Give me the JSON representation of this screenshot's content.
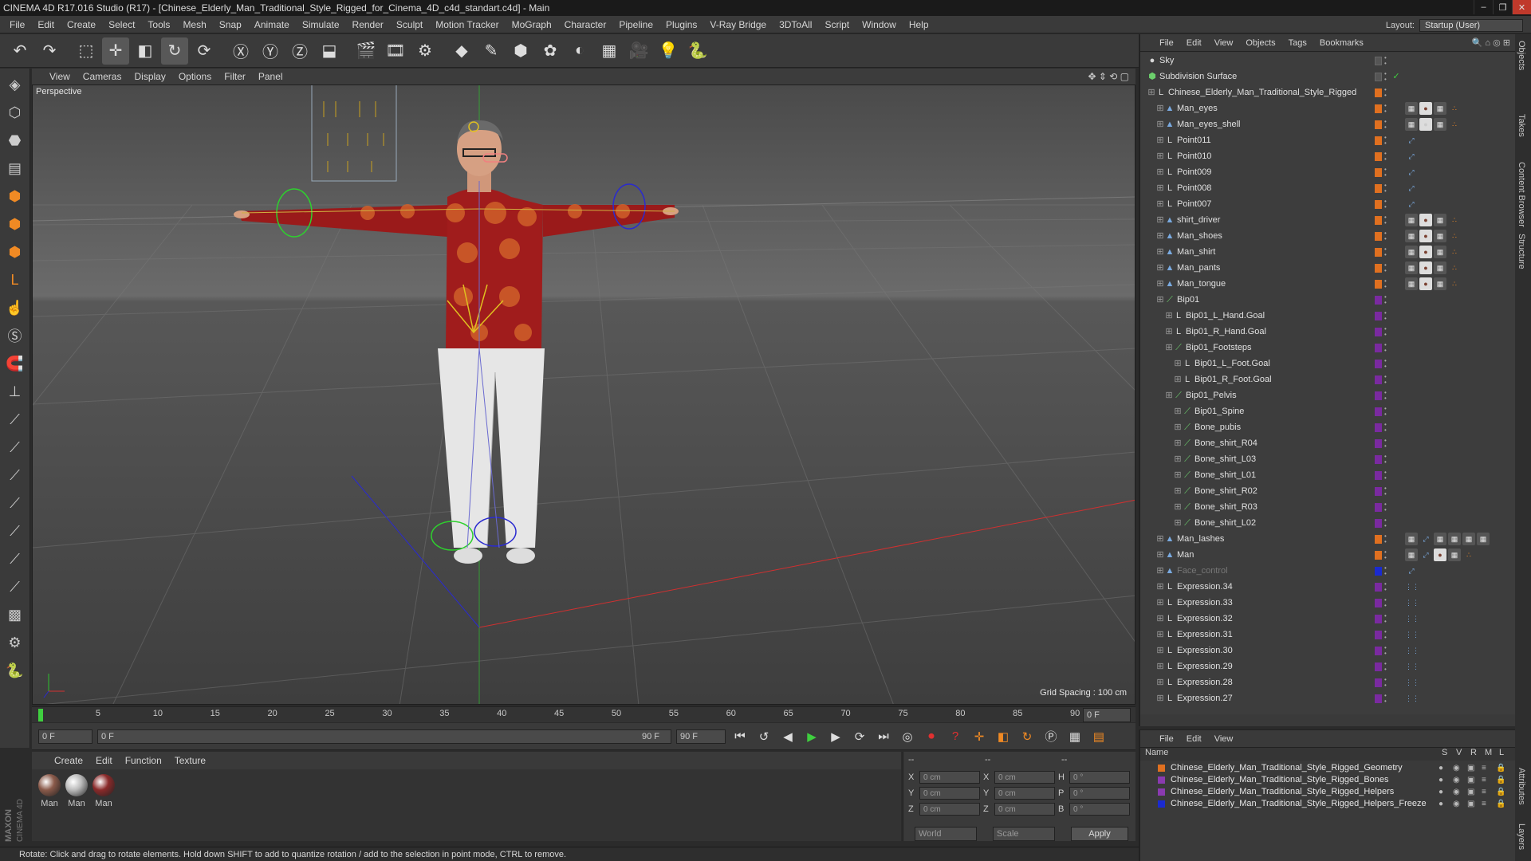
{
  "window": {
    "title": "CINEMA 4D R17.016 Studio (R17) - [Chinese_Elderly_Man_Traditional_Style_Rigged_for_Cinema_4D_c4d_standart.c4d] - Main",
    "controls": [
      "–",
      "❐",
      "✕"
    ]
  },
  "menubar": [
    "File",
    "Edit",
    "Create",
    "Select",
    "Tools",
    "Mesh",
    "Snap",
    "Animate",
    "Simulate",
    "Render",
    "Sculpt",
    "Motion Tracker",
    "MoGraph",
    "Character",
    "Pipeline",
    "Plugins",
    "V-Ray Bridge",
    "3DToAll",
    "Script",
    "Window",
    "Help"
  ],
  "layout": {
    "label": "Layout:",
    "value": "Startup (User)"
  },
  "toolbar": [
    {
      "name": "undo-icon",
      "glyph": "↶"
    },
    {
      "name": "redo-icon",
      "glyph": "↷"
    },
    {
      "sep": true
    },
    {
      "name": "live-select-icon",
      "glyph": "⬚"
    },
    {
      "name": "move-icon",
      "glyph": "✛",
      "hl": true
    },
    {
      "name": "scale-icon",
      "glyph": "◧"
    },
    {
      "name": "rotate-icon",
      "glyph": "↻",
      "hl": true
    },
    {
      "name": "recent-tool-icon",
      "glyph": "⟳"
    },
    {
      "sep": true
    },
    {
      "name": "x-axis-icon",
      "glyph": "Ⓧ"
    },
    {
      "name": "y-axis-icon",
      "glyph": "Ⓨ"
    },
    {
      "name": "z-axis-icon",
      "glyph": "Ⓩ"
    },
    {
      "name": "coordinate-system-icon",
      "glyph": "⬓"
    },
    {
      "sep": true
    },
    {
      "name": "render-view-icon",
      "glyph": "🎬"
    },
    {
      "name": "render-picture-viewer-icon",
      "glyph": "🎞"
    },
    {
      "name": "render-settings-icon",
      "glyph": "⚙"
    },
    {
      "sep": true
    },
    {
      "name": "cube-icon",
      "glyph": "◆"
    },
    {
      "name": "spline-pen-icon",
      "glyph": "✎"
    },
    {
      "name": "subdivision-icon",
      "glyph": "⬢"
    },
    {
      "name": "array-icon",
      "glyph": "✿"
    },
    {
      "name": "deformer-icon",
      "glyph": "◐"
    },
    {
      "name": "floor-icon",
      "glyph": "▦"
    },
    {
      "name": "camera-icon",
      "glyph": "🎥"
    },
    {
      "name": "light-icon",
      "glyph": "💡"
    },
    {
      "name": "python-icon",
      "glyph": "🐍"
    }
  ],
  "lefttools": [
    {
      "name": "model-mode-icon",
      "glyph": "◈"
    },
    {
      "name": "object-mode-icon",
      "glyph": "⬡"
    },
    {
      "name": "texture-mode-icon",
      "glyph": "⬣"
    },
    {
      "name": "workplane-icon",
      "glyph": "▤"
    },
    {
      "name": "points-mode-icon",
      "glyph": "⬢",
      "org": true
    },
    {
      "name": "edges-mode-icon",
      "glyph": "⬢",
      "org": true
    },
    {
      "name": "polygons-mode-icon",
      "glyph": "⬢",
      "org": true
    },
    {
      "name": "axis-mode-icon",
      "glyph": "L",
      "org": true
    },
    {
      "name": "tweak-mode-icon",
      "glyph": "☝"
    },
    {
      "name": "snap-icon",
      "glyph": "Ⓢ"
    },
    {
      "name": "magnet-icon",
      "glyph": "🧲",
      "org": true
    },
    {
      "name": "quantize-icon",
      "glyph": "⊥"
    },
    {
      "name": "joint-tool-icon",
      "glyph": "⟋"
    },
    {
      "name": "bone-tool-icon",
      "glyph": "⟋"
    },
    {
      "name": "ik-tool-icon",
      "glyph": "⟋"
    },
    {
      "name": "weight-tool-icon",
      "glyph": "⟋"
    },
    {
      "name": "paint-tool-icon",
      "glyph": "⟋"
    },
    {
      "name": "skin-tool-icon",
      "glyph": "⟋"
    },
    {
      "name": "mirror-tool-icon",
      "glyph": "⟋"
    },
    {
      "name": "checker-icon",
      "glyph": "▩"
    },
    {
      "name": "brush-icon",
      "glyph": "⚙"
    },
    {
      "name": "python-script-icon",
      "glyph": "🐍"
    }
  ],
  "viewport": {
    "menu": [
      "View",
      "Cameras",
      "Display",
      "Options",
      "Filter",
      "Panel"
    ],
    "label": "Perspective",
    "grid_spacing": "Grid Spacing : 100 cm"
  },
  "timeline": {
    "ticks": [
      "0",
      "5",
      "10",
      "15",
      "20",
      "25",
      "30",
      "35",
      "40",
      "45",
      "50",
      "55",
      "60",
      "65",
      "70",
      "75",
      "80",
      "85",
      "90"
    ],
    "current_frame": "0 F",
    "start": "0 F",
    "range_start": "0 F",
    "range_end": "90 F",
    "end": "90 F"
  },
  "materials": {
    "menu": [
      "Create",
      "Edit",
      "Function",
      "Texture"
    ],
    "items": [
      {
        "label": "Man",
        "color": "#8a5a4a"
      },
      {
        "label": "Man",
        "color": "#bbbbbb"
      },
      {
        "label": "Man",
        "color": "#8a2a2a"
      }
    ]
  },
  "coords": {
    "header": [
      "--",
      "--",
      "--"
    ],
    "rows": [
      {
        "a": "X",
        "v1": "0 cm",
        "b": "X",
        "v2": "0 cm",
        "c": "H",
        "v3": "0 °"
      },
      {
        "a": "Y",
        "v1": "0 cm",
        "b": "Y",
        "v2": "0 cm",
        "c": "P",
        "v3": "0 °"
      },
      {
        "a": "Z",
        "v1": "0 cm",
        "b": "Z",
        "v2": "0 cm",
        "c": "B",
        "v3": "0 °"
      }
    ],
    "world": "World",
    "scale": "Scale",
    "apply": "Apply"
  },
  "status": "Rotate: Click and drag to rotate elements. Hold down SHIFT to add to quantize rotation / add to the selection in point mode, CTRL to remove.",
  "objects": {
    "menu": [
      "File",
      "Edit",
      "View",
      "Objects",
      "Tags",
      "Bookmarks"
    ],
    "rows": [
      {
        "name": "Sky",
        "level": 0,
        "icon": "sky",
        "flag": "none",
        "tags": []
      },
      {
        "name": "Subdivision Surface",
        "level": 0,
        "icon": "sds",
        "flag": "none",
        "tags": [],
        "check": true
      },
      {
        "name": "Chinese_Elderly_Man_Traditional_Style_Rigged",
        "level": 1,
        "icon": "null",
        "flag": "orange",
        "tags": []
      },
      {
        "name": "Man_eyes",
        "level": 2,
        "icon": "mesh",
        "flag": "orange",
        "tags": [
          "ck",
          "mat",
          "ck",
          "wt"
        ]
      },
      {
        "name": "Man_eyes_shell",
        "level": 2,
        "icon": "mesh",
        "flag": "orange",
        "tags": [
          "ck",
          "mat2",
          "ck",
          "wt"
        ]
      },
      {
        "name": "Point011",
        "level": 2,
        "icon": "null",
        "flag": "orange",
        "tags": [
          "pin"
        ]
      },
      {
        "name": "Point010",
        "level": 2,
        "icon": "null",
        "flag": "orange",
        "tags": [
          "pin"
        ]
      },
      {
        "name": "Point009",
        "level": 2,
        "icon": "null",
        "flag": "orange",
        "tags": [
          "pin"
        ]
      },
      {
        "name": "Point008",
        "level": 2,
        "icon": "null",
        "flag": "orange",
        "tags": [
          "pin"
        ]
      },
      {
        "name": "Point007",
        "level": 2,
        "icon": "null",
        "flag": "orange",
        "tags": [
          "pin"
        ]
      },
      {
        "name": "shirt_driver",
        "level": 2,
        "icon": "mesh",
        "flag": "orange",
        "tags": [
          "ck",
          "mat",
          "ck",
          "wt"
        ]
      },
      {
        "name": "Man_shoes",
        "level": 2,
        "icon": "mesh",
        "flag": "orange",
        "tags": [
          "ck",
          "mat",
          "ck",
          "wt"
        ]
      },
      {
        "name": "Man_shirt",
        "level": 2,
        "icon": "mesh",
        "flag": "orange",
        "tags": [
          "ck",
          "mat",
          "ck",
          "wt"
        ]
      },
      {
        "name": "Man_pants",
        "level": 2,
        "icon": "mesh",
        "flag": "orange",
        "tags": [
          "ck",
          "mat",
          "ck",
          "wt"
        ]
      },
      {
        "name": "Man_tongue",
        "level": 2,
        "icon": "mesh",
        "flag": "orange",
        "tags": [
          "ck",
          "mat",
          "ck",
          "wt"
        ]
      },
      {
        "name": "Bip01",
        "level": 2,
        "icon": "bone",
        "flag": "purple",
        "tags": []
      },
      {
        "name": "Bip01_L_Hand.Goal",
        "level": 3,
        "icon": "null",
        "flag": "purple",
        "tags": []
      },
      {
        "name": "Bip01_R_Hand.Goal",
        "level": 3,
        "icon": "null",
        "flag": "purple",
        "tags": []
      },
      {
        "name": "Bip01_Footsteps",
        "level": 3,
        "icon": "bone",
        "flag": "purple",
        "tags": []
      },
      {
        "name": "Bip01_L_Foot.Goal",
        "level": 4,
        "icon": "null",
        "flag": "purple",
        "tags": []
      },
      {
        "name": "Bip01_R_Foot.Goal",
        "level": 4,
        "icon": "null",
        "flag": "purple",
        "tags": []
      },
      {
        "name": "Bip01_Pelvis",
        "level": 3,
        "icon": "bone",
        "flag": "purple",
        "tags": []
      },
      {
        "name": "Bip01_Spine",
        "level": 4,
        "icon": "bone",
        "flag": "purple",
        "tags": []
      },
      {
        "name": "Bone_pubis",
        "level": 4,
        "icon": "bone",
        "flag": "purple",
        "tags": []
      },
      {
        "name": "Bone_shirt_R04",
        "level": 4,
        "icon": "bone",
        "flag": "purple",
        "tags": []
      },
      {
        "name": "Bone_shirt_L03",
        "level": 4,
        "icon": "bone",
        "flag": "purple",
        "tags": []
      },
      {
        "name": "Bone_shirt_L01",
        "level": 4,
        "icon": "bone",
        "flag": "purple",
        "tags": []
      },
      {
        "name": "Bone_shirt_R02",
        "level": 4,
        "icon": "bone",
        "flag": "purple",
        "tags": []
      },
      {
        "name": "Bone_shirt_R03",
        "level": 4,
        "icon": "bone",
        "flag": "purple",
        "tags": []
      },
      {
        "name": "Bone_shirt_L02",
        "level": 4,
        "icon": "bone",
        "flag": "purple",
        "tags": []
      },
      {
        "name": "Man_lashes",
        "level": 2,
        "icon": "mesh",
        "flag": "orange",
        "tags": [
          "ck",
          "pin",
          "ck",
          "ck",
          "ck",
          "ck"
        ]
      },
      {
        "name": "Man",
        "level": 2,
        "icon": "mesh",
        "flag": "orange",
        "tags": [
          "ck",
          "pin",
          "mat",
          "ck",
          "wt"
        ]
      },
      {
        "name": "Face_control",
        "level": 2,
        "icon": "mesh",
        "flag": "blue",
        "tags": [
          "pin"
        ],
        "dim": true
      },
      {
        "name": "Expression.34",
        "level": 2,
        "icon": "null",
        "flag": "purple",
        "tags": [
          "xp"
        ]
      },
      {
        "name": "Expression.33",
        "level": 2,
        "icon": "null",
        "flag": "purple",
        "tags": [
          "xp"
        ]
      },
      {
        "name": "Expression.32",
        "level": 2,
        "icon": "null",
        "flag": "purple",
        "tags": [
          "xp"
        ]
      },
      {
        "name": "Expression.31",
        "level": 2,
        "icon": "null",
        "flag": "purple",
        "tags": [
          "xp"
        ]
      },
      {
        "name": "Expression.30",
        "level": 2,
        "icon": "null",
        "flag": "purple",
        "tags": [
          "xp"
        ]
      },
      {
        "name": "Expression.29",
        "level": 2,
        "icon": "null",
        "flag": "purple",
        "tags": [
          "xp"
        ]
      },
      {
        "name": "Expression.28",
        "level": 2,
        "icon": "null",
        "flag": "purple",
        "tags": [
          "xp"
        ]
      },
      {
        "name": "Expression.27",
        "level": 2,
        "icon": "null",
        "flag": "purple",
        "tags": [
          "xp"
        ]
      }
    ]
  },
  "layers": {
    "menu": [
      "File",
      "Edit",
      "View"
    ],
    "header": {
      "name": "Name",
      "cols": [
        "S",
        "V",
        "R",
        "M",
        "L"
      ]
    },
    "rows": [
      {
        "name": "Chinese_Elderly_Man_Traditional_Style_Rigged_Geometry",
        "color": "#e07020"
      },
      {
        "name": "Chinese_Elderly_Man_Traditional_Style_Rigged_Bones",
        "color": "#8a3ab0"
      },
      {
        "name": "Chinese_Elderly_Man_Traditional_Style_Rigged_Helpers",
        "color": "#8a3ab0"
      },
      {
        "name": "Chinese_Elderly_Man_Traditional_Style_Rigged_Helpers_Freeze",
        "color": "#1a2ad0"
      }
    ]
  },
  "sidetabs": [
    "Objects",
    "Takes",
    "Content Browser",
    "Structure",
    "Attributes",
    "Layers"
  ],
  "brand": "MAXON CINEMA 4D"
}
